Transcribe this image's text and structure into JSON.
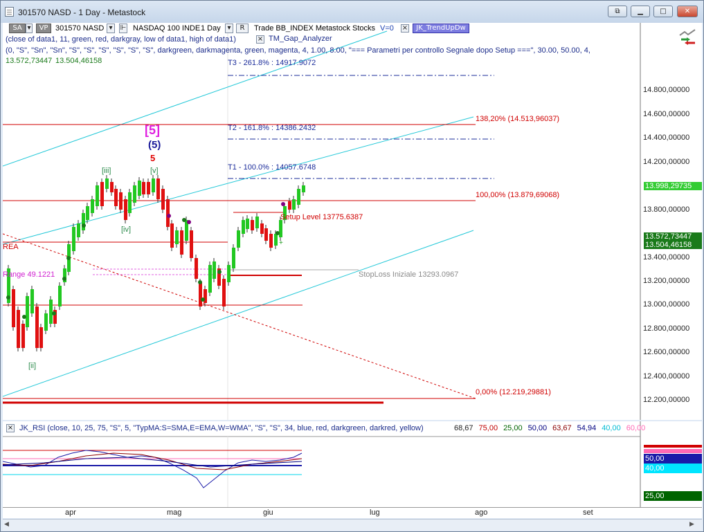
{
  "window": {
    "title": "301570 NASD - 1 Day - Metastock"
  },
  "toolbar": {
    "sa": "SA",
    "vp": "VP",
    "symbol": "301570 NASD",
    "name": "NASDAQ 100 INDE",
    "period": "1 Day",
    "r": "R",
    "trade_label": "Trade BB_INDEX Metastock Stocks",
    "v_label": "V=0",
    "indicator_tag": "JK_TrendUpDw",
    "close_x": "×",
    "indicator2": "TM_Gap_Analyzer"
  },
  "params": {
    "line1": "(close of data1, 11, green, red, darkgray, low of data1, high of data1)",
    "line2": "(0, \"S\", \"Sn\", \"Sn\", \"S\", \"S\", \"S\", \"S\", \"S\", \"S\", darkgreen, darkmagenta, green, magenta, 4, 1.00, 8.00, \"=== Parametri per controllo Segnale dopo Setup ===\", 30.00, 50.00, 4,",
    "line3_a": "13.572,73447",
    "line3_b": "13.504,46158"
  },
  "chart": {
    "yaxis_ticks": [
      "14.800,00000",
      "14.600,00000",
      "14.400,00000",
      "14.200,00000",
      "13.800,00000",
      "13.400,00000",
      "13.200,00000",
      "13.000,00000",
      "12.800,00000",
      "12.600,00000",
      "12.400,00000",
      "12.200,00000"
    ],
    "last_price": "13.998,29735",
    "tag1": "13.572,73447",
    "tag2": "13.504,46158",
    "t3": "T3 - 261.8% : 14917.9072",
    "t2": "T2 - 161.8% : 14386.2432",
    "t1": "T1 - 100.0% : 14057.6748",
    "fib138": "138,20% (14.513,96037)",
    "fib100": "100,00% (13.879,69068)",
    "fib0": "0,00% (12.219,29881)",
    "setup": "Setup Level 13775.6387",
    "stoploss": "StopLoss Iniziale 13293.0967",
    "range": "Range 49.1221",
    "area": "REA",
    "waves": {
      "w5_box": "[5]",
      "w5_paren": "(5)",
      "w5": "5",
      "wv": "[v]",
      "wiii": "[iii]",
      "wiv": "[iv]",
      "wii": "[ii]"
    },
    "plus": "+"
  },
  "rsi_panel": {
    "header": "JK_RSI   (close,  10,  25,  75,  \"S\",  5,  \"TypMA:S=SMA,E=EMA,W=WMA\",  \"S\",  \"S\",  34,  blue,  red,  darkgreen,  darkred,  yellow)",
    "values": [
      {
        "text": "68,67",
        "color": "#222222"
      },
      {
        "text": "75,00",
        "color": "#c00000"
      },
      {
        "text": "25,00",
        "color": "#006400"
      },
      {
        "text": "50,00",
        "color": "#000080"
      },
      {
        "text": "63,67",
        "color": "#8b0000"
      },
      {
        "text": "54,94",
        "color": "#000080"
      },
      {
        "text": "40,00",
        "color": "#00bcd4"
      },
      {
        "text": "60,00",
        "color": "#ff69b4"
      }
    ],
    "right_labels": {
      "l50": "50,00",
      "l40": "40,00",
      "l25": "25,00"
    }
  },
  "xaxis": {
    "months": [
      "apr",
      "mag",
      "giu",
      "lug",
      "ago",
      "set"
    ]
  }
}
